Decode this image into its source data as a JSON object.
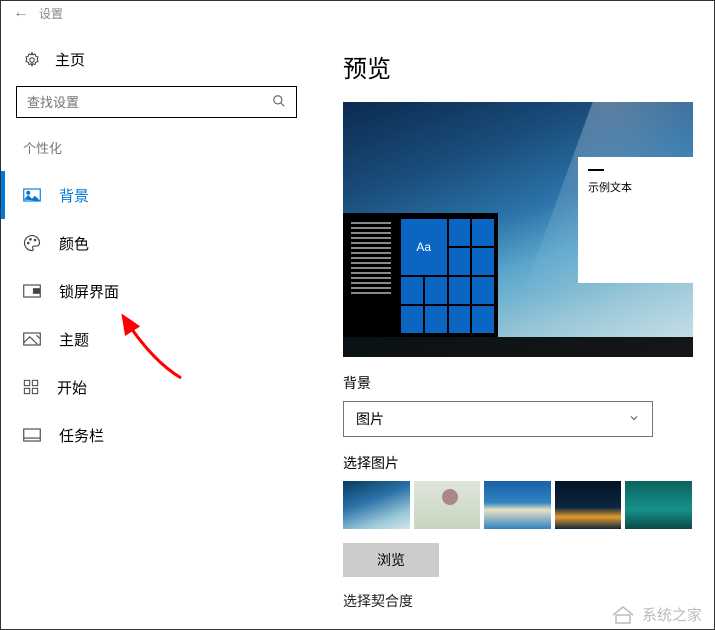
{
  "titlebar": {
    "back": "←",
    "title": "设置"
  },
  "sidebar": {
    "home": "主页",
    "search_placeholder": "查找设置",
    "category": "个性化",
    "items": [
      {
        "label": "背景"
      },
      {
        "label": "颜色"
      },
      {
        "label": "锁屏界面"
      },
      {
        "label": "主题"
      },
      {
        "label": "开始"
      },
      {
        "label": "任务栏"
      }
    ]
  },
  "main": {
    "preview_heading": "预览",
    "sample_text": "示例文本",
    "tile_text": "Aa",
    "background_label": "背景",
    "background_dropdown_value": "图片",
    "choose_picture_label": "选择图片",
    "browse_button": "浏览",
    "fit_label": "选择契合度"
  },
  "watermark": "系统之家"
}
